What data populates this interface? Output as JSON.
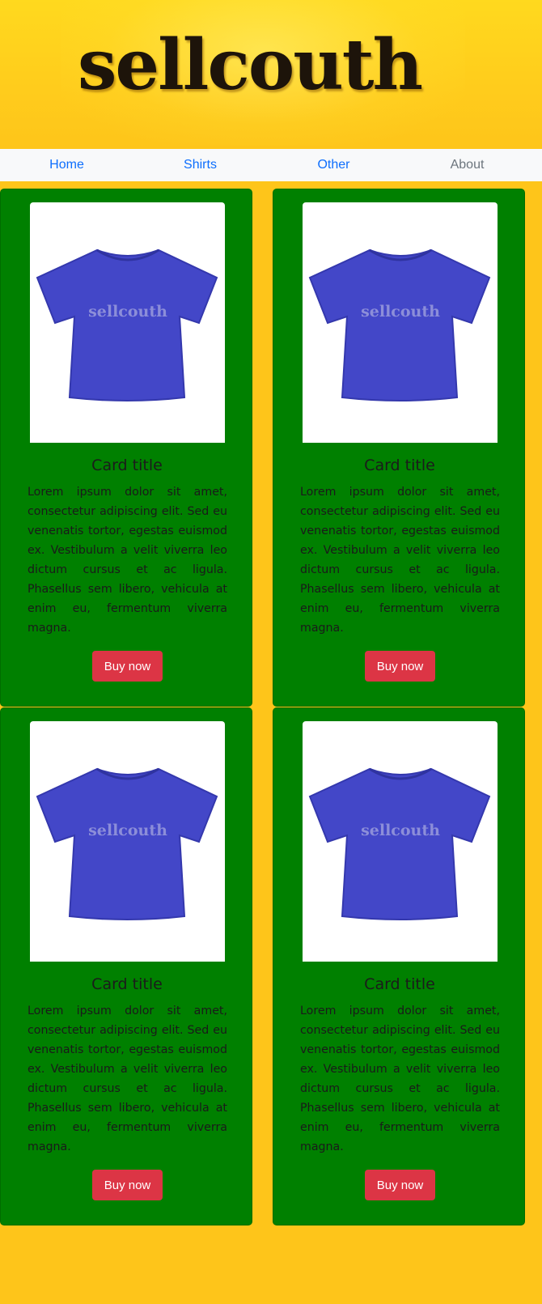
{
  "header": {
    "logo": "sellcouth",
    "nav": [
      {
        "label": "Home"
      },
      {
        "label": "Shirts"
      },
      {
        "label": "Other"
      },
      {
        "label": "About"
      }
    ]
  },
  "cards": [
    {
      "image_label": "sellcouth",
      "title": "Card title",
      "text": "Lorem ipsum dolor sit amet, consectetur adipiscing elit. Sed eu venenatis tortor, egestas euismod ex. Vestibulum a velit viverra leo dictum cursus et ac ligula. Phasellus sem libero, vehicula at enim eu, fermentum viverra magna.",
      "button": "Buy now"
    },
    {
      "image_label": "sellcouth",
      "title": "Card title",
      "text": "Lorem ipsum dolor sit amet, consectetur adipiscing elit. Sed eu venenatis tortor, egestas euismod ex. Vestibulum a velit viverra leo dictum cursus et ac ligula. Phasellus sem libero, vehicula at enim eu, fermentum viverra magna.",
      "button": "Buy now"
    },
    {
      "image_label": "sellcouth",
      "title": "Card title",
      "text": "Lorem ipsum dolor sit amet, consectetur adipiscing elit. Sed eu venenatis tortor, egestas euismod ex. Vestibulum a velit viverra leo dictum cursus et ac ligula. Phasellus sem libero, vehicula at enim eu, fermentum viverra magna.",
      "button": "Buy now"
    },
    {
      "image_label": "sellcouth",
      "title": "Card title",
      "text": "Lorem ipsum dolor sit amet, consectetur adipiscing elit. Sed eu venenatis tortor, egestas euismod ex. Vestibulum a velit viverra leo dictum cursus et ac ligula. Phasellus sem libero, vehicula at enim eu, fermentum viverra magna.",
      "button": "Buy now"
    }
  ],
  "colors": {
    "page_bg": "#fec51a",
    "navbar_bg": "#f8f9fa",
    "nav_link": "#0d6efd",
    "nav_link_muted": "#6c757d",
    "card_bg": "#008000",
    "button_bg": "#dc3545",
    "shirt": "#4347c8"
  }
}
